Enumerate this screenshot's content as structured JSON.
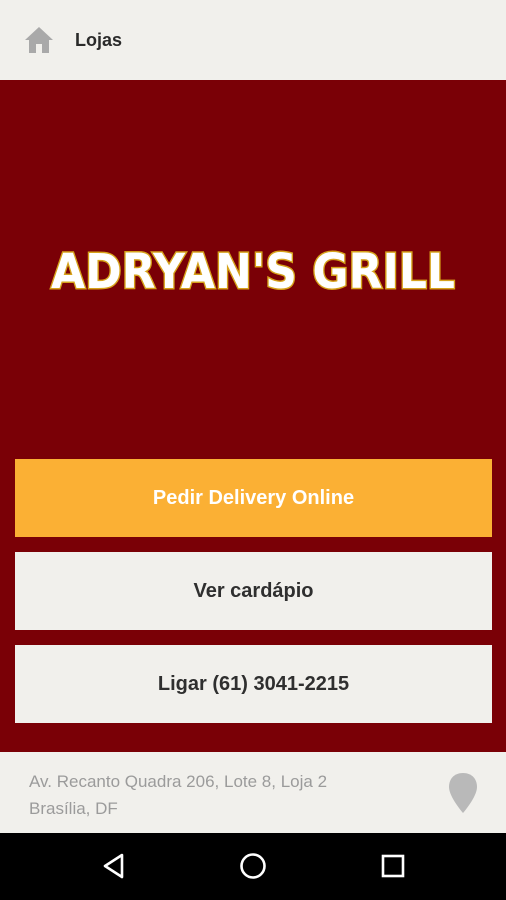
{
  "header": {
    "title": "Lojas",
    "home_icon": "home-icon"
  },
  "hero": {
    "logo_text": "ADRYAN'S GRILL"
  },
  "actions": {
    "delivery_label": "Pedir Delivery Online",
    "menu_label": "Ver cardápio",
    "call_label": "Ligar (61) 3041-2215"
  },
  "footer": {
    "address_line1": "Av. Recanto Quadra 206, Lote 8, Loja 2",
    "address_line2": "Brasília, DF",
    "map_icon": "location-pin-icon"
  },
  "system_nav": {
    "back_icon": "back-triangle-icon",
    "home_icon": "home-circle-icon",
    "recents_icon": "recents-square-icon"
  },
  "colors": {
    "brand_red": "#7a0006",
    "accent_orange": "#fbb034",
    "panel_bg": "#f1f0ec",
    "logo_outline": "#d6a21a"
  }
}
